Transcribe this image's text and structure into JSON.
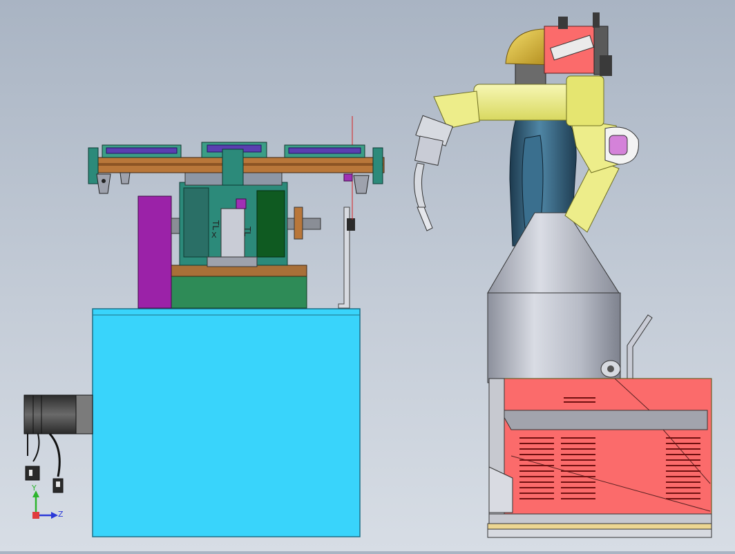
{
  "viewport": {
    "background_top": "#a9b4c3",
    "background_bottom": "#d7dde5"
  },
  "triad": {
    "y_label": "Y",
    "z_label": "Z",
    "y_color": "#2db52d",
    "z_color": "#2a38d8"
  },
  "fixture_labels": {
    "text_a": "TL",
    "text_b": "X",
    "text_c": "TL"
  },
  "colors": {
    "base_cyan": "#39d4fb",
    "fixture_teal": "#2c8a7a",
    "fixture_green": "#2e8b57",
    "motor_purple": "#9b22a8",
    "plate_brown": "#b9773a",
    "robot_yellow": "#eded8a",
    "torso_blue": "#2f5a74",
    "cone_silver": "#c9ccd6",
    "controller_red": "#fb6b6b"
  }
}
